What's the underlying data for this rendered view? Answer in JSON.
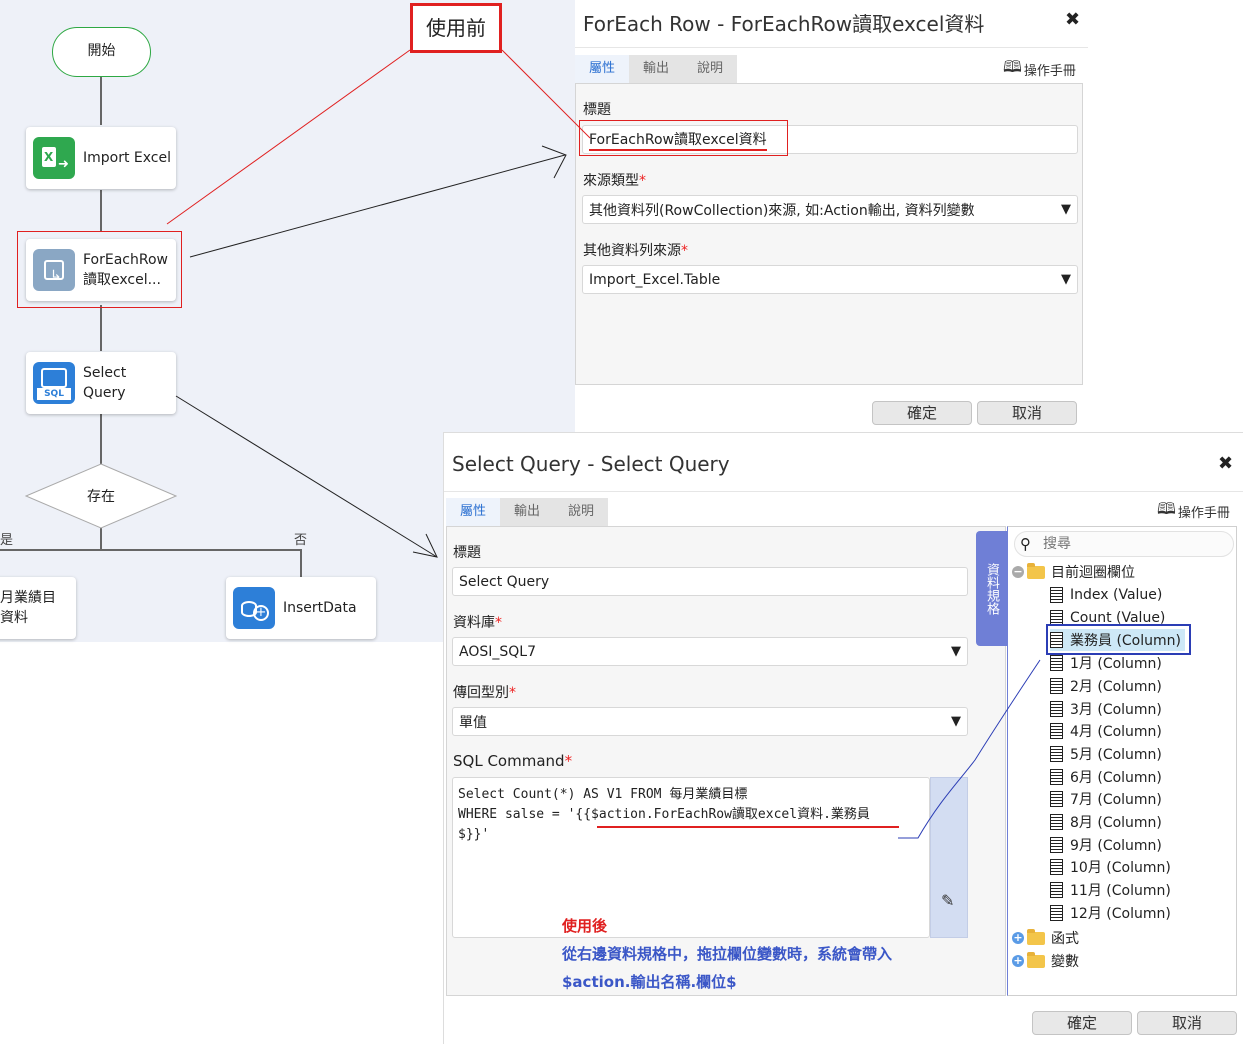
{
  "flow": {
    "start_label": "開始",
    "import_label": "Import Excel",
    "foreach_label_1": "ForEachRow",
    "foreach_label_2": "讀取excel...",
    "select_label_1": "Select",
    "select_label_2": "Query",
    "decision_label": "存在",
    "yes_label": "是",
    "no_label": "否",
    "left_node_1": "月業績目",
    "left_node_2": "資料",
    "insert_label": "InsertData",
    "sql_badge": "SQL"
  },
  "annotation_before": "使用前",
  "foreach_dialog": {
    "title": "ForEach Row - ForEachRow讀取excel資料",
    "tabs": [
      "屬性",
      "輸出",
      "說明"
    ],
    "manual": "操作手冊",
    "title_label": "標題",
    "title_value": "ForEachRow讀取excel資料",
    "source_type_label": "來源類型",
    "source_type_value": "其他資料列(RowCollection)來源, 如:Action輸出, 資料列變數",
    "other_source_label": "其他資料列來源",
    "other_source_value": "Import_Excel.Table",
    "ok": "確定",
    "cancel": "取消"
  },
  "select_dialog": {
    "title": "Select Query - Select Query",
    "tabs": [
      "屬性",
      "輸出",
      "說明"
    ],
    "manual": "操作手冊",
    "title_label": "標題",
    "title_value": "Select Query",
    "db_label": "資料庫",
    "db_value": "AOSI_SQL7",
    "return_label": "傳回型別",
    "return_value": "單值",
    "sql_label": "SQL Command",
    "sql_line1": "Select Count(*) AS V1 FROM 每月業績目標",
    "sql_line2": "WHERE salse = '{{$action.ForEachRow讀取excel資料.業務員",
    "sql_line3": "$}}'",
    "spec_tab": "資料規格",
    "search_placeholder": "搜尋",
    "tree": {
      "root": "目前迴圈欄位",
      "items": [
        "Index (Value)",
        "Count (Value)",
        "業務員 (Column)",
        "1月 (Column)",
        "2月 (Column)",
        "3月 (Column)",
        "4月 (Column)",
        "5月 (Column)",
        "6月 (Column)",
        "7月 (Column)",
        "8月 (Column)",
        "9月 (Column)",
        "10月 (Column)",
        "11月 (Column)",
        "12月 (Column)"
      ],
      "functions": "函式",
      "variables": "變數"
    },
    "ok": "確定",
    "cancel": "取消"
  },
  "annotation_after": {
    "title": "使用後",
    "line1": "從右邊資料規格中，拖拉欄位變數時，系統會帶入",
    "line2": "$action.輸出名稱.欄位$"
  },
  "colors": {
    "highlight_red": "#e02020",
    "highlight_blue": "#2b3db5",
    "note_blue": "#3b57c7",
    "tab_blue": "#2a6fd1",
    "spec_purple": "#6f7fd6"
  }
}
